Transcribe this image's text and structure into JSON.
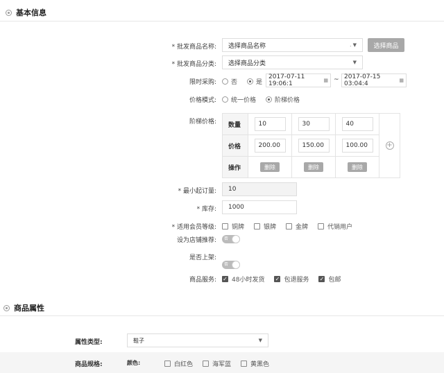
{
  "sections": {
    "basic": "基本信息",
    "attrs": "商品属性"
  },
  "form": {
    "name_label": "* 批发商品名称:",
    "name_placeholder": "选择商品名称",
    "select_button": "选择商品",
    "category_label": "* 批发商品分类:",
    "category_placeholder": "选择商品分类",
    "limit_label": "限时采购:",
    "limit_options": [
      "否",
      "是"
    ],
    "limit_selected": "是",
    "start_time": "2017-07-11 19:06:1",
    "end_time": "2017-07-15 03:04:4",
    "range_sep": "~",
    "price_mode_label": "价格模式:",
    "price_mode_options": [
      "统一价格",
      "阶梯价格"
    ],
    "price_mode_selected": "阶梯价格",
    "tier_label": "阶梯价格:",
    "tier_table": {
      "qty_label": "数量",
      "price_label": "价格",
      "op_label": "操作",
      "qty": [
        "10",
        "30",
        "40"
      ],
      "price": [
        "200.00",
        "150.00",
        "100.00"
      ],
      "delete_label": "删除"
    },
    "min_order_label": "* 最小起订量:",
    "min_order_value": "10",
    "stock_label": "* 库存:",
    "stock_value": "1000",
    "member_label": "* 适用会员等级:",
    "member_options": [
      "铜牌",
      "银牌",
      "金牌",
      "代销用户"
    ],
    "recommend_label": "设为店铺推荐:",
    "recommend_toggle": "否",
    "onshelf_label": "是否上架:",
    "onshelf_toggle": "否",
    "service_label": "商品服务:",
    "service_options": [
      "48小时发货",
      "包退服务",
      "包邮"
    ]
  },
  "attrs": {
    "type_label": "属性类型:",
    "type_value": "鞋子",
    "spec_label": "商品规格:",
    "color_label": "颜色:",
    "colors": [
      "白红色",
      "海军蓝",
      "黄黑色"
    ]
  }
}
